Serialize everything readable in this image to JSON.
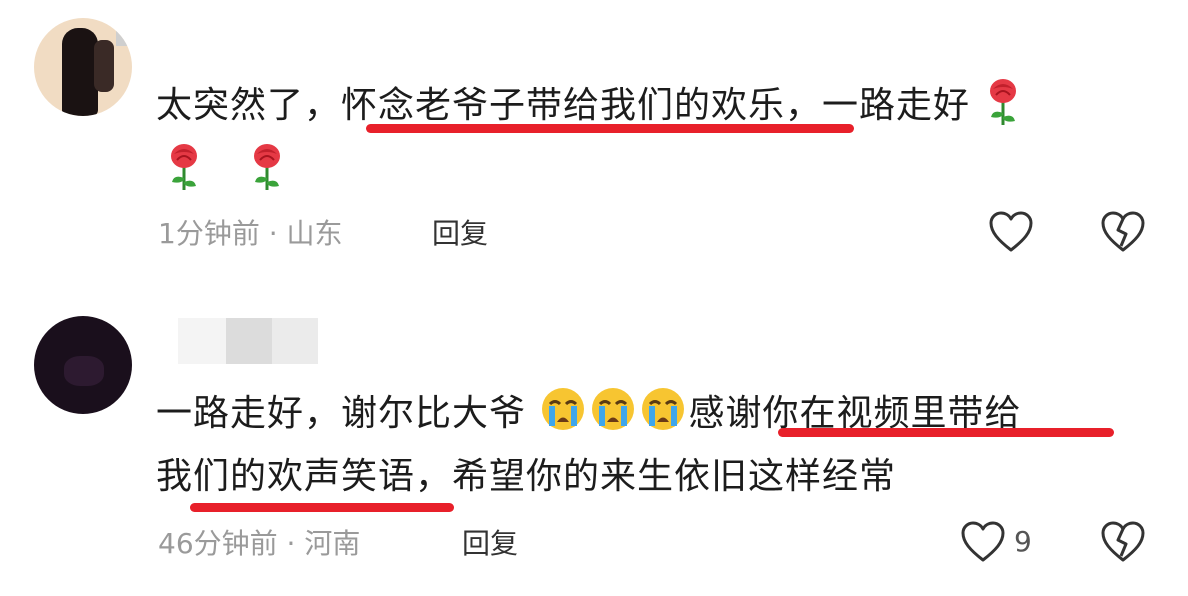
{
  "comments": [
    {
      "line1": "太突然了，怀念老爷子带给我们的欢乐，一路走好",
      "line1_parts": [
        "太突然了，",
        "怀念老爷子带给我们的欢乐",
        "，一路走好"
      ],
      "time": "1分钟前",
      "separator": "·",
      "location": "山东",
      "reply_label": "回复",
      "like_count": "",
      "emoji_icons": [
        "rose-icon",
        "rose-icon",
        "rose-icon"
      ]
    },
    {
      "line1_parts": [
        "一路走好，谢尔比大爷",
        "感谢你在视频里带给"
      ],
      "line2_parts": [
        "我们的欢声笑语",
        "，希望你的来生依旧这样经常"
      ],
      "time": "46分钟前",
      "separator": "·",
      "location": "河南",
      "reply_label": "回复",
      "like_count": "9",
      "emoji_icons": [
        "crying-face-icon",
        "crying-face-icon",
        "crying-face-icon"
      ]
    }
  ],
  "colors": {
    "highlight_underline": "#e8202a",
    "meta_text": "#9a9a9a",
    "body_text": "#1c1c1c"
  }
}
